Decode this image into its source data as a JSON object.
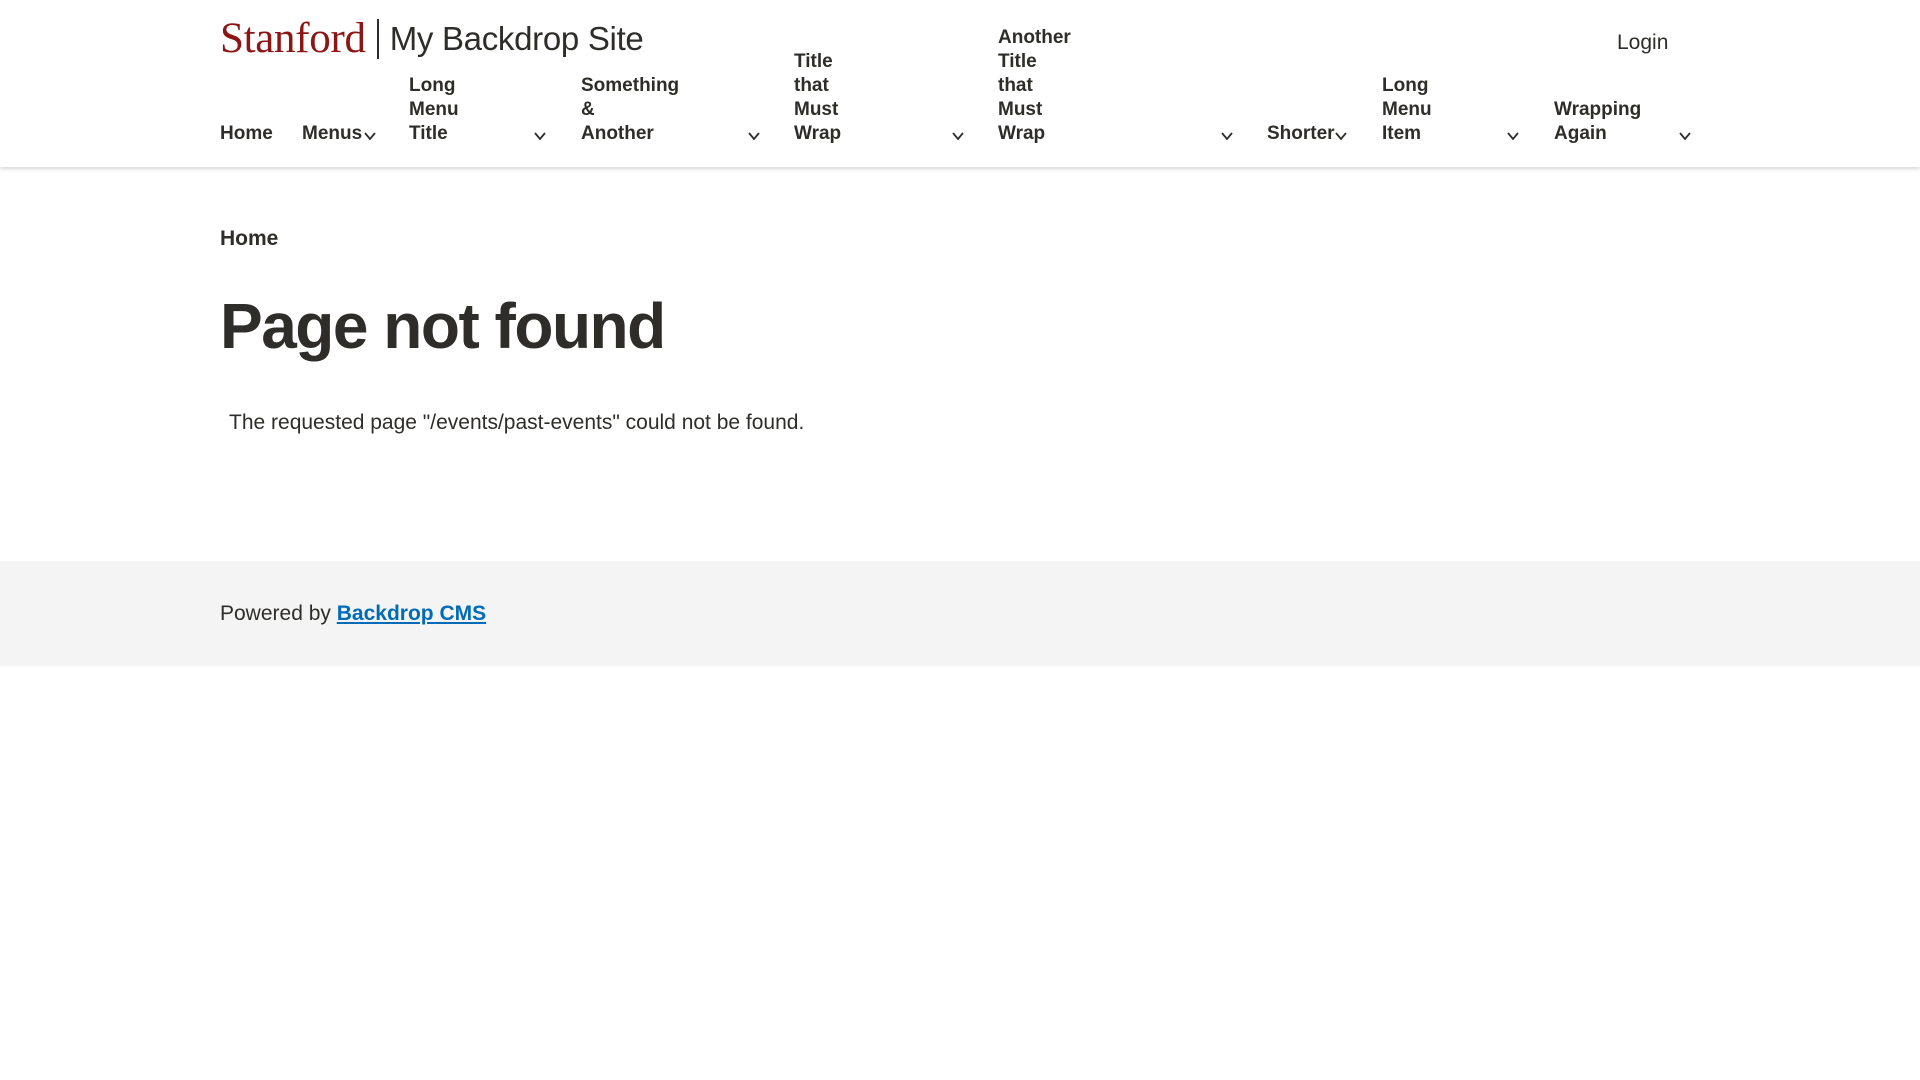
{
  "header": {
    "wordmark": "Stanford",
    "site_name": "My Backdrop Site",
    "login_label": "Login"
  },
  "nav": {
    "items": [
      {
        "line1": "",
        "line2": "Home",
        "has_submenu": false
      },
      {
        "line1": "",
        "line2": "Menus",
        "has_submenu": true
      },
      {
        "line1": "Long Menu",
        "line2": "Title",
        "has_submenu": true
      },
      {
        "line1": "Something &",
        "line2": "Another",
        "has_submenu": true
      },
      {
        "line1": "Title that Must",
        "line2": "Wrap",
        "has_submenu": true
      },
      {
        "line1": "Another Title that Must",
        "line2": "Wrap",
        "has_submenu": true
      },
      {
        "line1": "",
        "line2": "Shorter",
        "has_submenu": true
      },
      {
        "line1": "Long Menu",
        "line2": "Item",
        "has_submenu": true
      },
      {
        "line1": "Wrapping",
        "line2": "Again",
        "has_submenu": true
      }
    ]
  },
  "breadcrumb": {
    "home_label": "Home"
  },
  "main": {
    "title": "Page not found",
    "message": "The requested page \"/events/past-events\" could not be found."
  },
  "footer": {
    "powered_by": "Powered by",
    "link_label": "Backdrop CMS"
  },
  "colors": {
    "brand_red": "#8c1515",
    "text": "#2e2d29",
    "link_blue": "#006cb8",
    "footer_bg": "#f4f4f4"
  },
  "icons": {
    "submenu": "chevron-down-icon"
  }
}
